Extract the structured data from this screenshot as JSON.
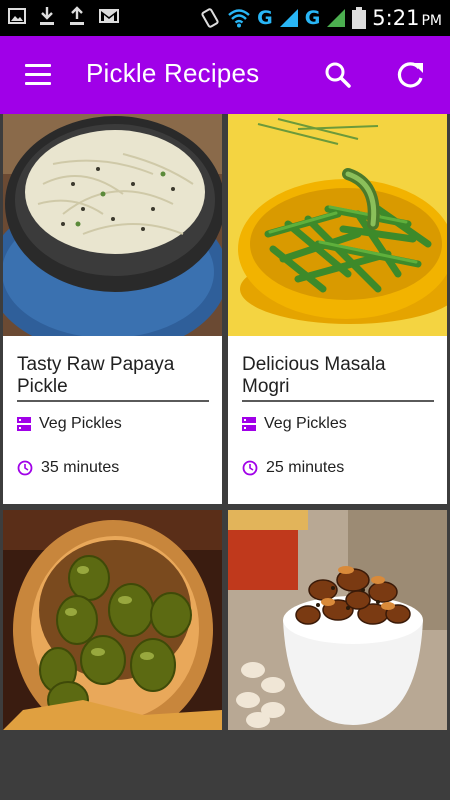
{
  "status_bar": {
    "time": "5:21",
    "ampm": "PM",
    "network_1": "G",
    "network_2": "G"
  },
  "app_bar": {
    "title": "Pickle Recipes",
    "menu_icon": "hamburger-menu-icon",
    "search_icon": "search-icon",
    "refresh_icon": "refresh-icon"
  },
  "accent_color": "#a000e8",
  "recipes": [
    {
      "title": "Tasty Raw Papaya Pickle",
      "category": "Veg Pickles",
      "time": "35 minutes"
    },
    {
      "title": "Delicious Masala Mogri",
      "category": "Veg Pickles",
      "time": "25 minutes"
    },
    {
      "title": "",
      "category": "",
      "time": ""
    },
    {
      "title": "",
      "category": "",
      "time": ""
    }
  ]
}
